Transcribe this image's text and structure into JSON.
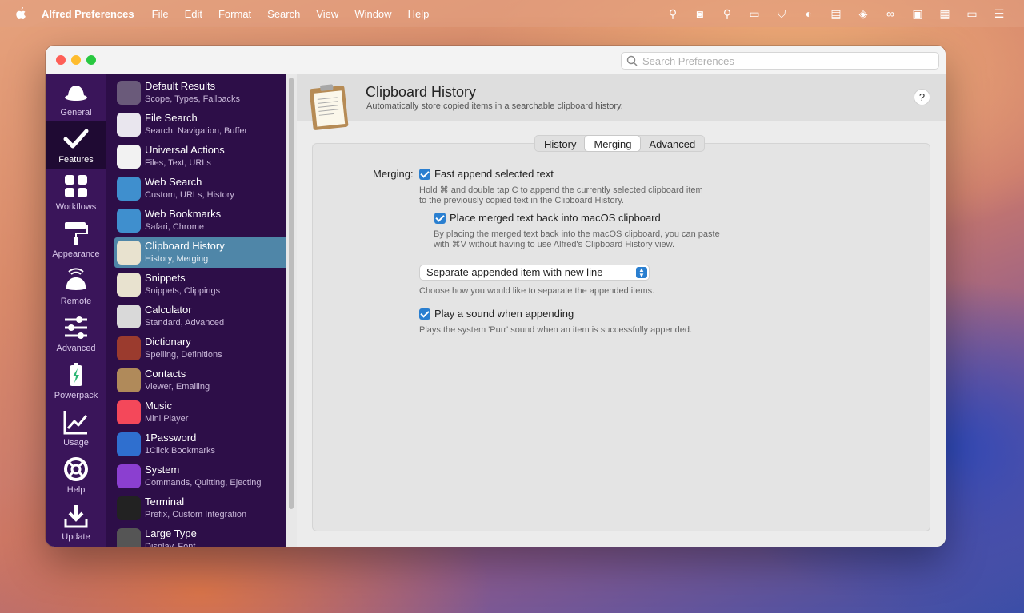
{
  "menubar": {
    "app_name": "Alfred Preferences",
    "menus": [
      "File",
      "Edit",
      "Format",
      "Search",
      "View",
      "Window",
      "Help"
    ],
    "status_icons": [
      "broom-icon",
      "camera-icon",
      "magnifier-icon",
      "screen-icon",
      "shield-icon",
      "contrast-icon",
      "keyboard-icon",
      "layers-icon",
      "link-icon",
      "card-icon",
      "menu-icon",
      "battery-icon",
      "control-center-icon"
    ]
  },
  "window": {
    "search_placeholder": "Search Preferences"
  },
  "rail": [
    {
      "label": "General",
      "icon": "hat-icon"
    },
    {
      "label": "Features",
      "icon": "checkmark-icon",
      "active": true
    },
    {
      "label": "Workflows",
      "icon": "grid-icon"
    },
    {
      "label": "Appearance",
      "icon": "paint-roller-icon"
    },
    {
      "label": "Remote",
      "icon": "remote-icon"
    },
    {
      "label": "Advanced",
      "icon": "sliders-icon"
    },
    {
      "label": "Powerpack",
      "icon": "battery-bolt-icon"
    },
    {
      "label": "Usage",
      "icon": "chart-line-icon"
    },
    {
      "label": "Help",
      "icon": "lifebuoy-icon"
    },
    {
      "label": "Update",
      "icon": "download-icon"
    }
  ],
  "features": [
    {
      "title": "Default Results",
      "sub": "Scope, Types, Fallbacks",
      "icon": "default-results-icon",
      "color": "#6a5a7a"
    },
    {
      "title": "File Search",
      "sub": "Search, Navigation, Buffer",
      "icon": "file-search-icon",
      "color": "#e9e6ee"
    },
    {
      "title": "Universal Actions",
      "sub": "Files, Text, URLs",
      "icon": "universal-actions-icon",
      "color": "#f2f2f2"
    },
    {
      "title": "Web Search",
      "sub": "Custom, URLs, History",
      "icon": "web-search-icon",
      "color": "#3f8fce"
    },
    {
      "title": "Web Bookmarks",
      "sub": "Safari, Chrome",
      "icon": "globe-bookmark-icon",
      "color": "#3f8fce"
    },
    {
      "title": "Clipboard History",
      "sub": "History, Merging",
      "icon": "clipboard-icon",
      "color": "#e8e2cf",
      "active": true
    },
    {
      "title": "Snippets",
      "sub": "Snippets, Clippings",
      "icon": "snippets-icon",
      "color": "#e8e2cf"
    },
    {
      "title": "Calculator",
      "sub": "Standard, Advanced",
      "icon": "calculator-icon",
      "color": "#d9d9d9"
    },
    {
      "title": "Dictionary",
      "sub": "Spelling, Definitions",
      "icon": "dictionary-icon",
      "color": "#9b3b2e"
    },
    {
      "title": "Contacts",
      "sub": "Viewer, Emailing",
      "icon": "contacts-icon",
      "color": "#b08a5a"
    },
    {
      "title": "Music",
      "sub": "Mini Player",
      "icon": "music-icon",
      "color": "#f4485a"
    },
    {
      "title": "1Password",
      "sub": "1Click Bookmarks",
      "icon": "onepassword-icon",
      "color": "#2f6fcf"
    },
    {
      "title": "System",
      "sub": "Commands, Quitting, Ejecting",
      "icon": "power-icon",
      "color": "#8b3fd0"
    },
    {
      "title": "Terminal",
      "sub": "Prefix, Custom Integration",
      "icon": "terminal-icon",
      "color": "#222222"
    },
    {
      "title": "Large Type",
      "sub": "Display, Font",
      "icon": "large-type-icon",
      "color": "#555555"
    }
  ],
  "main": {
    "title": "Clipboard History",
    "subtitle": "Automatically store copied items in a searchable clipboard history.",
    "help_label": "?",
    "tabs": [
      "History",
      "Merging",
      "Advanced"
    ],
    "active_tab": "Merging",
    "merging_label": "Merging:",
    "fast_append": {
      "label": "Fast append selected text",
      "checked": true,
      "hint": "Hold ⌘ and double tap C to append the currently selected clipboard item to the previously copied text in the Clipboard History."
    },
    "place_back": {
      "label": "Place merged text back into macOS clipboard",
      "checked": true,
      "hint": "By placing the merged text back into the macOS clipboard, you can paste with ⌘V without having to use Alfred's Clipboard History view."
    },
    "separator_select": {
      "value": "Separate appended item with new line",
      "hint": "Choose how you would like to separate the appended items."
    },
    "play_sound": {
      "label": "Play a sound when appending",
      "checked": true,
      "hint": "Plays the system 'Purr' sound when an item is successfully appended."
    }
  },
  "colors": {
    "rail_bg": "#3a155a",
    "list_bg": "#2d0e48",
    "selection": "#4f86a8",
    "checkbox": "#2a7fd0"
  }
}
